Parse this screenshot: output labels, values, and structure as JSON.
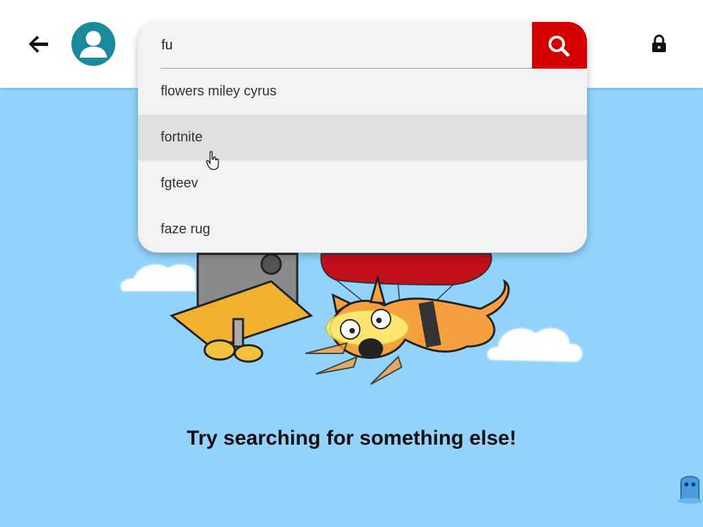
{
  "header": {
    "back_icon": "arrow-left-icon",
    "avatar_icon": "user-avatar-icon",
    "lock_icon": "lock-icon"
  },
  "search": {
    "value": "fu",
    "search_icon": "magnifier-icon",
    "button_color": "#d40000",
    "suggestions": [
      {
        "label": "flowers miley cyrus"
      },
      {
        "label": "fortnite"
      },
      {
        "label": "fgteev"
      },
      {
        "label": "faze rug"
      }
    ],
    "hovered_index": 1
  },
  "main": {
    "empty_message": "Try searching for something else!",
    "background_color": "#93d2fb"
  }
}
